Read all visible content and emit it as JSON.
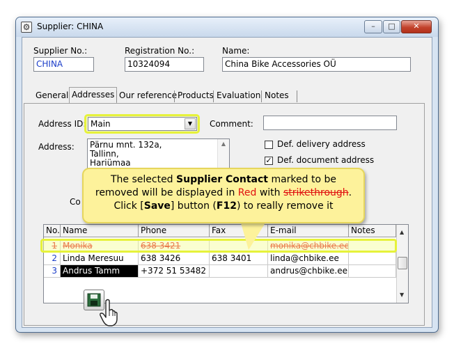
{
  "window": {
    "title": "Supplier: CHINA",
    "min_label": "–",
    "max_label": "□",
    "close_label": "✕"
  },
  "header": {
    "supplier_no_label": "Supplier No.:",
    "supplier_no_value": "CHINA",
    "registration_no_label": "Registration No.:",
    "registration_no_value": "10324094",
    "name_label": "Name:",
    "name_value": "China Bike Accessories OÜ"
  },
  "tabs": [
    "General",
    "Addresses",
    "Our reference",
    "Products",
    "Evaluation",
    "Notes"
  ],
  "active_tab": "Addresses",
  "addresses": {
    "address_id_label": "Address ID:",
    "address_id_value": "Main",
    "comment_label": "Comment:",
    "comment_value": "",
    "address_label": "Address:",
    "address_lines": [
      "Pärnu mnt. 132a,",
      "Tallinn,",
      "Hariümaa"
    ],
    "def_delivery_label": "Def. delivery address",
    "def_delivery_checked": false,
    "def_document_label": "Def. document address",
    "def_document_checked": true,
    "partial_label": "Co"
  },
  "callout": {
    "line1_pre": "The selected ",
    "line1_bold": "Supplier Contact",
    "line1_post": " marked to be",
    "line2_pre": "removed will be displayed in ",
    "line2_red": "Red",
    "line2_mid": " with ",
    "line2_strike": "strikethrough",
    "line2_post": ".",
    "line3_pre": "Click [",
    "line3_bold1": "Save",
    "line3_mid": "] button (",
    "line3_bold2": "F12",
    "line3_post": ") to really remove it"
  },
  "contacts": {
    "columns": [
      "No.",
      "Name",
      "Phone",
      "Fax",
      "E-mail",
      "Notes"
    ],
    "rows": [
      {
        "no": "1",
        "name": "Monika",
        "phone": "638 3421",
        "fax": "",
        "email": "monika@chbike.ee",
        "notes": "",
        "marked_for_removal": true
      },
      {
        "no": "2",
        "name": "Linda Meresuu",
        "phone": "638 3426",
        "fax": "638 3401",
        "email": "linda@chbike.ee",
        "notes": "",
        "marked_for_removal": false
      },
      {
        "no": "3",
        "name": "Andrus Tamm",
        "phone": "+372 51 53482",
        "fax": "",
        "email": "andrus@chbike.ee",
        "notes": "",
        "marked_for_removal": false
      }
    ]
  },
  "colors": {
    "highlight": "#e6f23a",
    "callout_bg": "#fdf29b",
    "removed_text": "#e01010"
  }
}
